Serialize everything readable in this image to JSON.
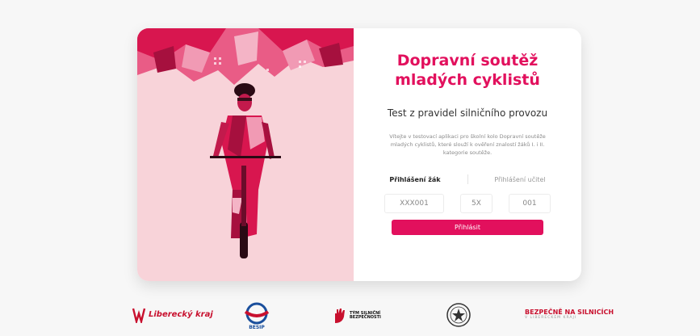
{
  "header": {
    "title": "Dopravní soutěž mladých cyklistů",
    "subtitle": "Test z pravidel silničního provozu",
    "intro": "Vítejte v testovací aplikaci pro školní kolo Dopravní soutěže mladých cyklistů, které slouží k ověření znalostí žáků I. i II. kategorie soutěže."
  },
  "login": {
    "tabs": [
      {
        "label": "Přihlášení žák",
        "active": true
      },
      {
        "label": "Přihlášení učitel",
        "active": false
      }
    ],
    "fields": {
      "school_code_placeholder": "XXX001",
      "class_placeholder": "5X",
      "student_number_placeholder": "001"
    },
    "submit_label": "Přihlásit"
  },
  "colors": {
    "accent": "#e2105d",
    "left_panel_bg": "#f8d3d9",
    "page_bg": "#f7f7f7"
  },
  "footer": {
    "logos": [
      {
        "name": "liberecky-kraj-logo",
        "text": "Liberecký kraj"
      },
      {
        "name": "besip-logo",
        "text": "BESIP"
      },
      {
        "name": "tym-silnicni-bezpecnosti-logo",
        "text": "TÝM SILNIČNÍ BEZPEČNOSTI"
      },
      {
        "name": "policie-cr-logo",
        "text": ""
      },
      {
        "name": "bezpecne-na-silnicich-logo",
        "text": "BEZPEČNĚ NA SILNICÍCH",
        "subtext": "V LIBERECKÉM KRAJI"
      }
    ]
  }
}
